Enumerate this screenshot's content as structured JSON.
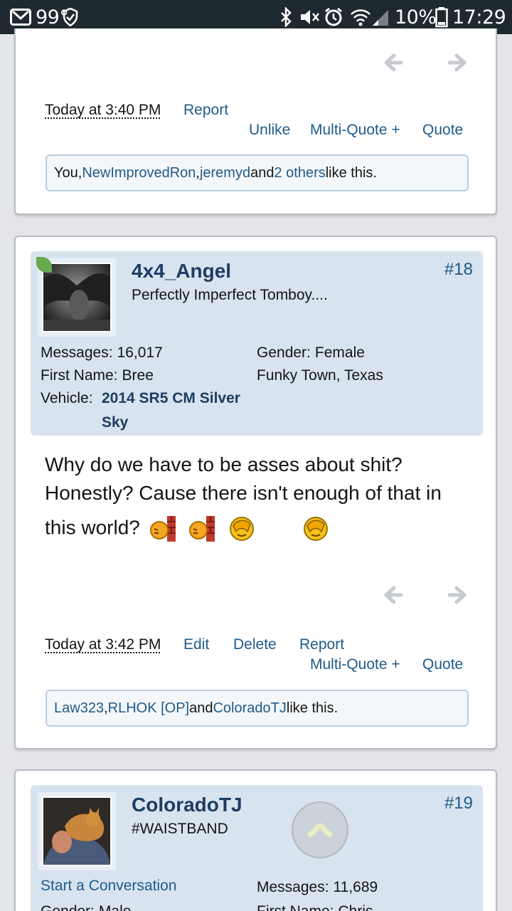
{
  "status_bar": {
    "temperature": "99°",
    "battery": "10%",
    "time": "17:29",
    "icons": [
      "gmail-icon",
      "shield-check-icon",
      "bluetooth-icon",
      "mute-icon",
      "alarm-icon",
      "wifi-icon",
      "signal-icon",
      "battery-icon"
    ]
  },
  "post17": {
    "timestamp": "Today at 3:40 PM",
    "report": "Report",
    "unlike": "Unlike",
    "multiquote": "Multi-Quote +",
    "quote": "Quote",
    "likes": {
      "you": "You, ",
      "user1": "NewImprovedRon",
      "sep1": ", ",
      "user2": "jeremyd",
      "and": " and ",
      "others": "2 others",
      "suffix": " like this."
    }
  },
  "post18": {
    "username": "4x4_Angel",
    "user_title": "Perfectly Imperfect Tomboy....",
    "post_number": "#18",
    "messages_label": "Messages:",
    "messages_value": "16,017",
    "first_name_label": "First Name:",
    "first_name_value": "Bree",
    "vehicle_label": "Vehicle:",
    "vehicle_line1": "2014 SR5 CM Silver",
    "vehicle_line2": "Sky",
    "gender_label": "Gender:",
    "gender_value": "Female",
    "location": "Funky Town, Texas",
    "body_line1": "Why do we have to be asses about shit?",
    "body_line2": "Honestly? Cause there isn't enough of that in",
    "body_line3": "this world?",
    "timestamp": "Today at 3:42 PM",
    "edit": "Edit",
    "delete": "Delete",
    "report": "Report",
    "multiquote": "Multi-Quote +",
    "quote": "Quote",
    "likes": {
      "user1": "Law323",
      "sep1": ", ",
      "user2": "RLHOK [OP]",
      "and": " and ",
      "user3": "ColoradoTJ",
      "suffix": " like this."
    }
  },
  "post19": {
    "username": "ColoradoTJ",
    "user_title": "#WAISTBAND",
    "post_number": "#19",
    "start_conversation": "Start a Conversation",
    "messages_label": "Messages:",
    "messages_value": "11,689",
    "gender_label": "Gender:",
    "gender_value": "Male",
    "first_name_label": "First Name:",
    "first_name_value": "Chris"
  },
  "colors": {
    "link": "#1f5a8a",
    "username": "#1d3d63",
    "userinfo_bg": "#d7e3ef",
    "status_bar_bg": "#1f2a30"
  }
}
